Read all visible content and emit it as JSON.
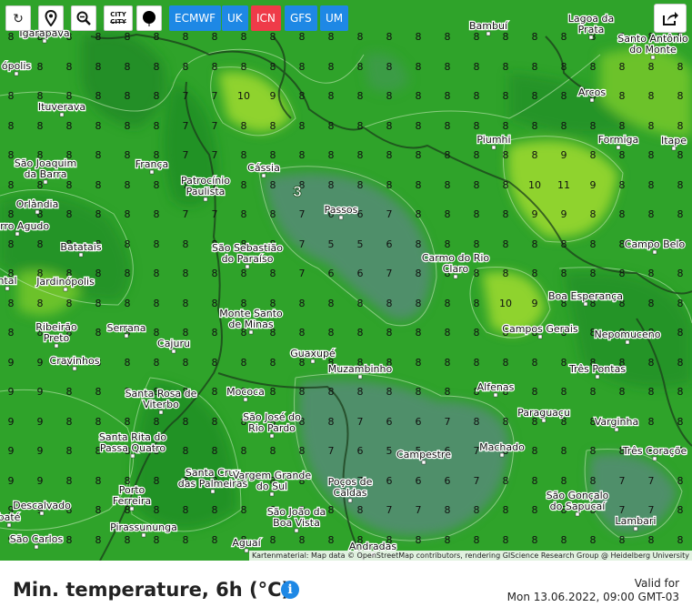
{
  "toolbar": {
    "reload_icon": "reload-icon",
    "pin_icon": "map-pin-icon",
    "zoom_out_icon": "zoom-out-icon",
    "city_label_top": "CITY",
    "city_label_bottom": "CITY",
    "dot_icon": "dot-icon",
    "models": [
      {
        "label": "ECMWF",
        "active": false
      },
      {
        "label": "UK",
        "active": false
      },
      {
        "label": "ICN",
        "active": true
      },
      {
        "label": "GFS",
        "active": false
      },
      {
        "label": "UM",
        "active": false
      }
    ],
    "share_icon": "share-icon"
  },
  "colors": {
    "active_model": "#ef3b49",
    "model_button": "#1e88e5",
    "map_green": "#2fa32a",
    "cold_zone": "#4f8f6b",
    "warm_zone": "#8fd32e",
    "info_icon": "#1e88e5"
  },
  "cities": [
    {
      "name": "Igarapava"
    },
    {
      "name": "Bambuí"
    },
    {
      "name": "Lagoa da Prata"
    },
    {
      "name": "Santo Antônio do Monte"
    },
    {
      "name": "ópolis"
    },
    {
      "name": "Arcos"
    },
    {
      "name": "Ituverava"
    },
    {
      "name": "Piumhi"
    },
    {
      "name": "Formiga"
    },
    {
      "name": "Itape"
    },
    {
      "name": "São Joaquim da Barra"
    },
    {
      "name": "França"
    },
    {
      "name": "Cássia"
    },
    {
      "name": "Patrocínio Paulista"
    },
    {
      "name": "Orlândia"
    },
    {
      "name": "Passos"
    },
    {
      "name": "Morro Agudo"
    },
    {
      "name": "Batatais"
    },
    {
      "name": "São Sebastião do Paraíso"
    },
    {
      "name": "Carmo do Rio Claro"
    },
    {
      "name": "Campo Belo"
    },
    {
      "name": "ntal"
    },
    {
      "name": "Jardinópolis"
    },
    {
      "name": "Boa Esperança"
    },
    {
      "name": "Monte Santo de Minas"
    },
    {
      "name": "Ribeirão Preto"
    },
    {
      "name": "Serrana"
    },
    {
      "name": "Campos Gerais"
    },
    {
      "name": "Nepomuceno"
    },
    {
      "name": "Cajuru"
    },
    {
      "name": "Guaxupé"
    },
    {
      "name": "Cravinhos"
    },
    {
      "name": "Muzambinho"
    },
    {
      "name": "Três Pontas"
    },
    {
      "name": "Santa Rosa de Viterbo"
    },
    {
      "name": "Alfenas"
    },
    {
      "name": "Mococa"
    },
    {
      "name": "São José do Rio Pardo"
    },
    {
      "name": "Paraguaçu"
    },
    {
      "name": "Varginha"
    },
    {
      "name": "Santa Rita do Passa Quatro"
    },
    {
      "name": "Machado"
    },
    {
      "name": "Três Coraçõe"
    },
    {
      "name": "Campestre"
    },
    {
      "name": "Santa Cruz das Palmeiras"
    },
    {
      "name": "Vargem Grande do Sul"
    },
    {
      "name": "Poços de Caldas"
    },
    {
      "name": "Porto Ferreira"
    },
    {
      "name": "São Gonçalo do Sapucaí"
    },
    {
      "name": "Descalvado"
    },
    {
      "name": "São João da Boa Vista"
    },
    {
      "name": "Lambari"
    },
    {
      "name": "Pirassununga"
    },
    {
      "name": "São Carlos"
    },
    {
      "name": "Aguaí"
    },
    {
      "name": "Andradas"
    },
    {
      "name": "baté"
    }
  ],
  "min_marker": "3",
  "attribution": "Kartenmaterial: Map data © OpenStreetMap contributors, rendering GIScience Research Group @ Heidelberg University",
  "footer": {
    "title": "Min. temperature, 6h (°C)",
    "info_icon": "info-icon",
    "valid_label": "Valid for",
    "valid_time": "Mon 13.06.2022, 09:00 GMT-03"
  }
}
